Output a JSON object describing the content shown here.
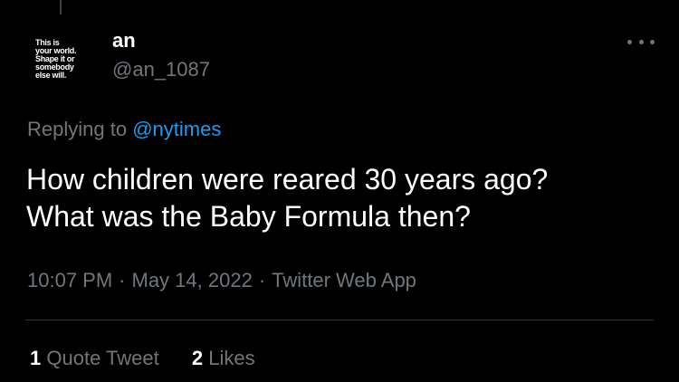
{
  "tweet": {
    "author": {
      "display_name": "an",
      "handle": "@an_1087",
      "avatar_text": "This is\nyour world.\nShape it or\nsomebody\nelse will."
    },
    "more_icon": "more-horizontal-icon",
    "replying_prefix": "Replying to",
    "replying_to": "@nytimes",
    "text_lines": [
      "How children were reared 30 years ago?",
      "What was the Baby Formula then?"
    ],
    "time": "10:07 PM",
    "date": "May 14, 2022",
    "source": "Twitter Web App",
    "separator": "·",
    "stats": [
      {
        "count": "1",
        "label": "Quote Tweet"
      },
      {
        "count": "2",
        "label": "Likes"
      }
    ]
  },
  "colors": {
    "background": "#000000",
    "primary_text": "#ffffff",
    "secondary_text": "#71767b",
    "link": "#1d9bf0",
    "divider": "#2f3336"
  }
}
